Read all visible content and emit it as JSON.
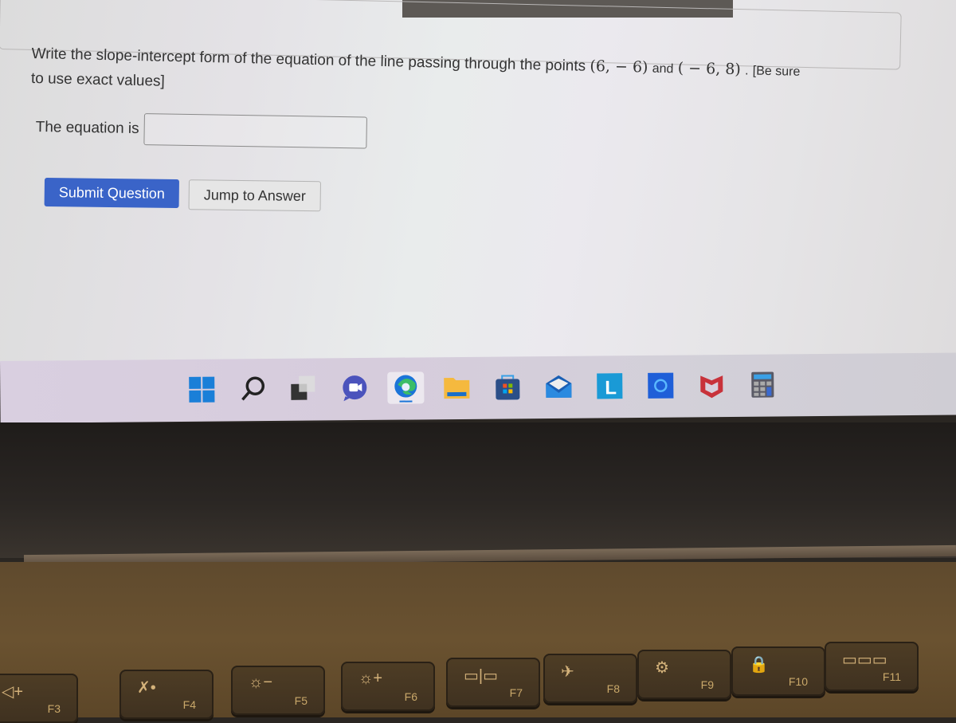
{
  "question": {
    "text_prefix": "Write the slope-intercept form of the equation of the line passing through the points",
    "point1": "(6, − 6)",
    "joiner": "and",
    "point2": "( − 6, 8)",
    "period": ".",
    "suffix_line1": "[Be sure",
    "suffix_line2": "to use exact values]"
  },
  "answer": {
    "label": "The equation is",
    "value": "",
    "placeholder": ""
  },
  "buttons": {
    "submit": "Submit Question",
    "jump": "Jump to Answer"
  },
  "taskbar": {
    "icons": [
      {
        "name": "start-icon"
      },
      {
        "name": "search-icon"
      },
      {
        "name": "task-view-icon"
      },
      {
        "name": "teams-chat-icon"
      },
      {
        "name": "edge-browser-icon",
        "active": true
      },
      {
        "name": "file-explorer-icon"
      },
      {
        "name": "microsoft-store-icon"
      },
      {
        "name": "mail-icon"
      },
      {
        "name": "l-app-icon",
        "letter": "L"
      },
      {
        "name": "cortana-icon"
      },
      {
        "name": "mcafee-icon"
      },
      {
        "name": "calculator-icon"
      }
    ]
  },
  "keyboard": {
    "keys": [
      {
        "label": "F3",
        "glyph": "◁+",
        "icon": "volume-up-icon"
      },
      {
        "label": "F4",
        "glyph": "✗•",
        "icon": "mic-mute-icon"
      },
      {
        "label": "F5",
        "glyph": "☼−",
        "icon": "brightness-down-icon"
      },
      {
        "label": "F6",
        "glyph": "☼+",
        "icon": "brightness-up-icon"
      },
      {
        "label": "F7",
        "glyph": "▭|▭",
        "icon": "display-switch-icon"
      },
      {
        "label": "F8",
        "glyph": "✈",
        "icon": "airplane-mode-icon"
      },
      {
        "label": "F9",
        "glyph": "⚙",
        "icon": "settings-icon"
      },
      {
        "label": "F10",
        "glyph": "🔒",
        "icon": "lock-icon"
      },
      {
        "label": "F11",
        "glyph": "▭▭▭",
        "icon": "keyboard-icon"
      }
    ]
  }
}
